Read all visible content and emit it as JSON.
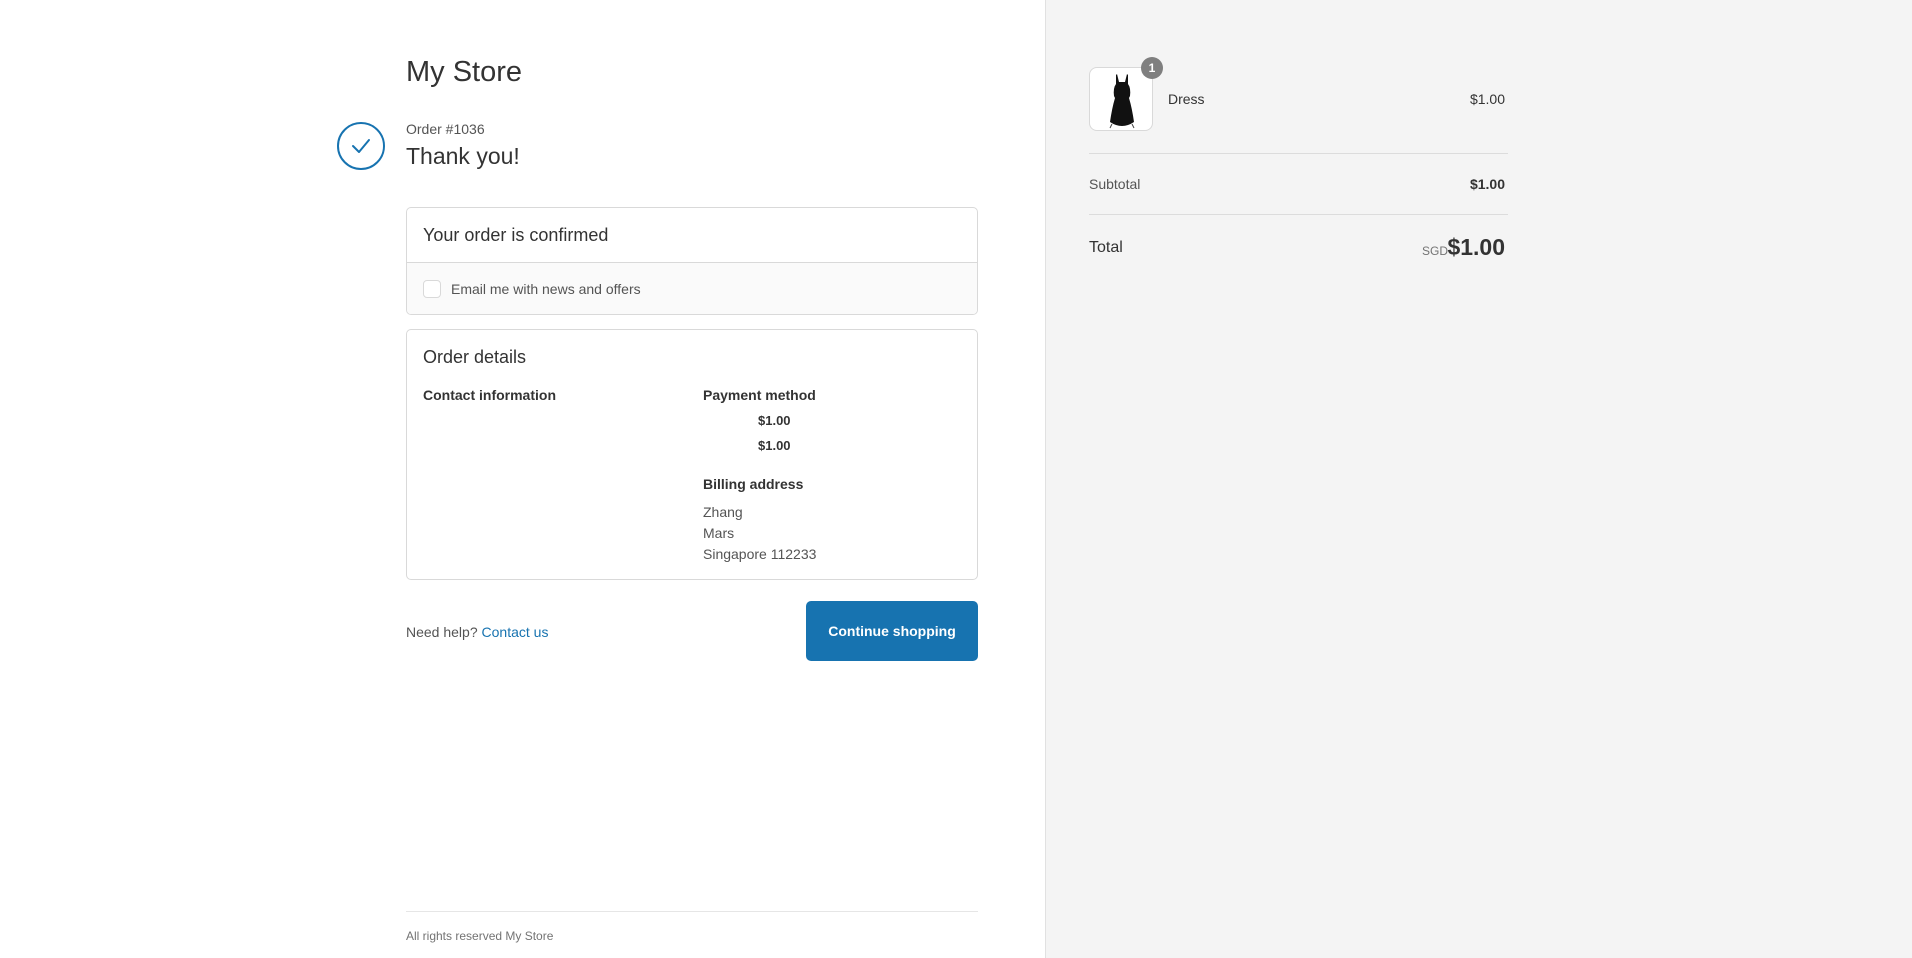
{
  "store": {
    "name": "My Store"
  },
  "order": {
    "number_label": "Order #1036",
    "thank_you": "Thank you!"
  },
  "confirmation": {
    "title": "Your order is confirmed",
    "newsletter_label": "Email me with news and offers",
    "newsletter_checked": false
  },
  "details": {
    "title": "Order details",
    "contact_heading": "Contact information",
    "payment_heading": "Payment method",
    "payment_lines": [
      "$1.00",
      "$1.00"
    ],
    "billing_heading": "Billing address",
    "billing_lines": [
      "Zhang",
      "Mars",
      "Singapore 112233"
    ]
  },
  "help": {
    "prefix": "Need help?",
    "link": "Contact us"
  },
  "continue_button": "Continue shopping",
  "footer": "All rights reserved My Store",
  "summary": {
    "item": {
      "name": "Dress",
      "price": "$1.00",
      "quantity": "1",
      "thumbnail_icon": "dress-icon"
    },
    "subtotal_label": "Subtotal",
    "subtotal_value": "$1.00",
    "total_label": "Total",
    "total_currency": "SGD",
    "total_value": "$1.00"
  },
  "colors": {
    "accent": "#1773b0",
    "sidebar_bg": "#f4f4f4"
  }
}
